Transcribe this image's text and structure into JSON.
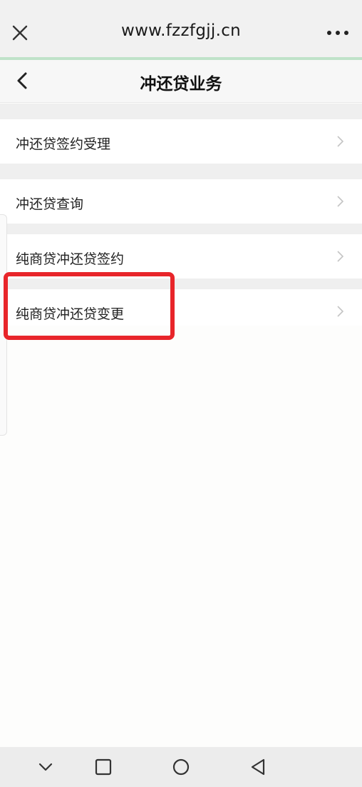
{
  "browser": {
    "url": "www.fzzfgjj.cn",
    "close_icon": "close-icon",
    "more_icon": "more-icon"
  },
  "page": {
    "title": "冲还贷业务",
    "back_icon": "chevron-left-icon"
  },
  "menu": {
    "items": [
      {
        "label": "冲还贷签约受理"
      },
      {
        "label": "冲还贷查询"
      },
      {
        "label": "纯商贷冲还贷签约"
      },
      {
        "label": "纯商贷冲还贷变更"
      }
    ],
    "highlighted_index": 3,
    "highlight_color": "#e8252a"
  },
  "system_nav": {
    "buttons": [
      "chevron-down-icon",
      "recent-apps-icon",
      "home-icon",
      "back-triangle-icon"
    ]
  },
  "colors": {
    "progress": "#bfe2c9",
    "background": "#efefef"
  }
}
